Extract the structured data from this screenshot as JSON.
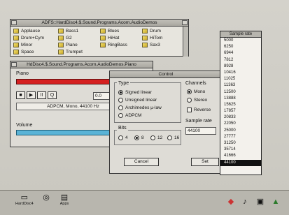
{
  "filer": {
    "title": "ADFS::HardDisc4.$.Sound.Programs.Acorn.AudioDemos",
    "files": [
      "Applause",
      "Bass1",
      "Blues",
      "Drum",
      "Drum+Cym",
      "G2",
      "HiHat",
      "HiTom",
      "Minor",
      "Piano",
      "RingBass",
      "Sax3",
      "Space",
      "Trumpet"
    ]
  },
  "player": {
    "title": "HdDisc4.$.Sound.Programs.Acorn.AudioDemos.Piano",
    "track_label": "Piano",
    "transport": [
      "■",
      "▶",
      "II",
      "Q"
    ],
    "time_value": "0.0",
    "info": "ADPCM, Mono, 44100 Hz",
    "volume_label": "Volume"
  },
  "control": {
    "title": "Control",
    "type_label": "Type",
    "types": [
      "Signed linear",
      "Unsigned linear",
      "Archimedes µ-law",
      "ADPCM"
    ],
    "selected_type": 0,
    "bits_label": "Bits",
    "bits": [
      "4",
      "8",
      "12",
      "16"
    ],
    "selected_bits": 1,
    "channels_label": "Channels",
    "channels": [
      "Mono",
      "Stereo"
    ],
    "reverse_label": "Reverse",
    "sample_label": "Sample rate",
    "sample_value": "44100",
    "cancel_label": "Cancel",
    "set_label": "Set"
  },
  "menu": {
    "title": "Sample rate",
    "items": [
      "5000",
      "6250",
      "6944",
      "7812",
      "8928",
      "10416",
      "11025",
      "11363",
      "12500",
      "13888",
      "15625",
      "17857",
      "20833",
      "22050",
      "25000",
      "27777",
      "31250",
      "35714",
      "41666",
      "44100"
    ],
    "selected_index": 19
  },
  "iconbar": {
    "left": [
      {
        "icon": "disc-icon",
        "label": "HardDisc4"
      },
      {
        "icon": "cd-icon",
        "label": ""
      },
      {
        "icon": "apps-icon",
        "label": "Apps"
      }
    ],
    "right": [
      {
        "icon": "palette-icon"
      },
      {
        "icon": "music-icon"
      },
      {
        "icon": "display-icon"
      },
      {
        "icon": "acorn-icon"
      }
    ]
  },
  "colors": {
    "piano_bar": "#d52020",
    "volume_bar": "#5ab3d6",
    "menu_highlight": "#111111"
  }
}
